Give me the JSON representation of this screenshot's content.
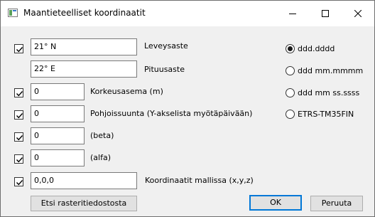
{
  "window": {
    "title": "Maantieteelliset koordinaatit"
  },
  "rows": [
    {
      "checked": true,
      "value": "21° N",
      "label": "Leveysaste"
    },
    {
      "checked": false,
      "value": "22° E",
      "label": "Pituusaste"
    },
    {
      "checked": true,
      "value": "0",
      "label": "Korkeusasema (m)"
    },
    {
      "checked": true,
      "value": "0",
      "label": "Pohjoissuunta (Y-akselista myötäpäivään)"
    },
    {
      "checked": true,
      "value": "0",
      "label": "(beta)"
    },
    {
      "checked": true,
      "value": "0",
      "label": "(alfa)"
    },
    {
      "checked": true,
      "value": "0,0,0",
      "label": "Koordinaatit mallissa (x,y,z)"
    }
  ],
  "format_options": [
    {
      "label": "ddd.dddd",
      "selected": true
    },
    {
      "label": "ddd  mm.mmmm",
      "selected": false
    },
    {
      "label": "ddd  mm  ss.ssss",
      "selected": false
    },
    {
      "label": "ETRS-TM35FIN",
      "selected": false
    }
  ],
  "buttons": {
    "raster": "Etsi rasteritiedostosta",
    "ok": "OK",
    "cancel": "Peruuta"
  },
  "icons": {
    "window_icon": "app-window-icon",
    "minimize": "minimize-icon",
    "maximize": "maximize-icon",
    "close": "close-icon",
    "check": "checkmark-icon"
  }
}
